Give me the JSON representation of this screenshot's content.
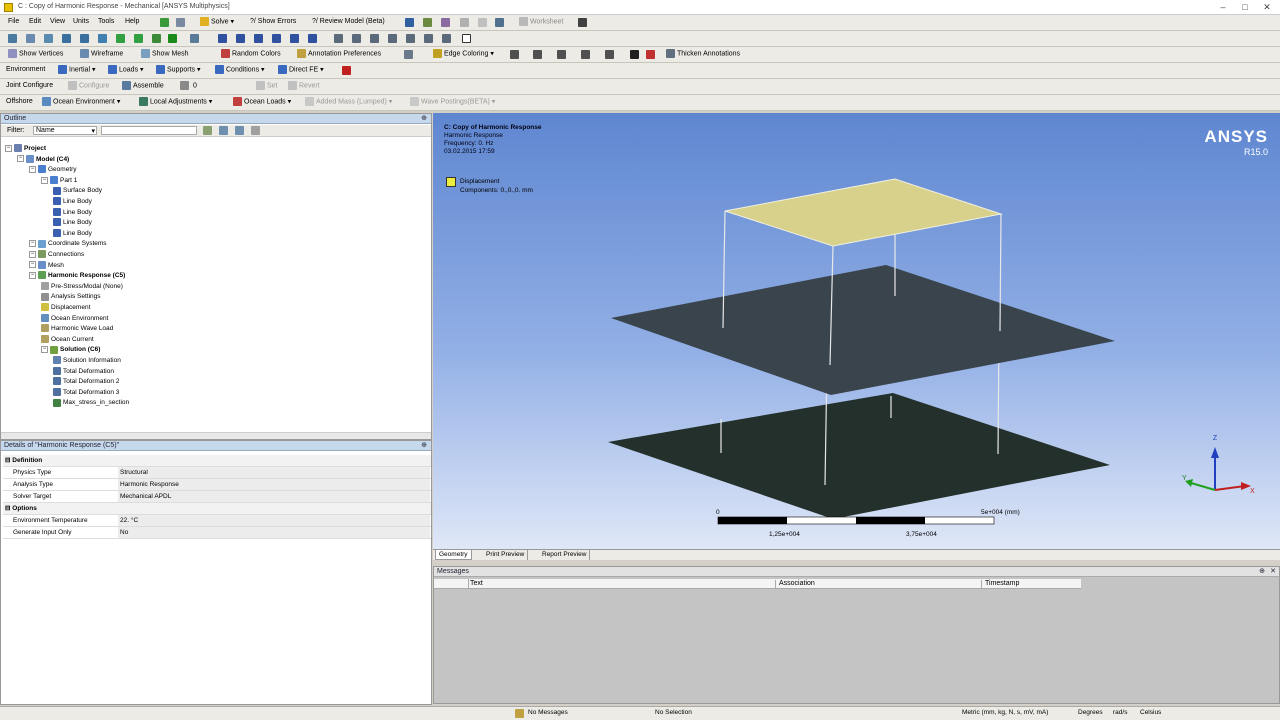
{
  "window": {
    "title": "C : Copy of Harmonic Response - Mechanical [ANSYS Multiphysics]"
  },
  "menu": [
    "File",
    "Edit",
    "View",
    "Units",
    "Tools",
    "Help"
  ],
  "toolbar1": {
    "solve": "Solve",
    "show_errors": "?/ Show Errors",
    "review_model": "?/ Review Model (Beta)",
    "worksheet": "Worksheet"
  },
  "toolbar2": {
    "show_vertices": "Show Vertices",
    "wireframe": "Wireframe",
    "show_mesh": "Show Mesh",
    "random_colors": "Random Colors",
    "annotation_prefs": "Annotation Preferences",
    "edge_coloring": "Edge Coloring",
    "thicken": "Thicken Annotations"
  },
  "toolbar3": {
    "label": "Environment",
    "inertial": "Inertial",
    "loads": "Loads",
    "supports": "Supports",
    "conditions": "Conditions",
    "direct_fe": "Direct FE"
  },
  "toolbar4": {
    "joint_configure": "Joint Configure",
    "configure": "Configure",
    "assemble": "Assemble",
    "set": "Set",
    "revert": "Revert"
  },
  "toolbar5": {
    "label": "Offshore",
    "ocean_env": "Ocean Environment",
    "local_adj": "Local Adjustments",
    "ocean_loads": "Ocean Loads",
    "added_mass": "Added Mass (Lumped)",
    "wave_postings": "Wave Postings(BETA)"
  },
  "outline": {
    "title": "Outline",
    "filter_label": "Filter:",
    "filter_value": "Name",
    "tree": [
      {
        "label": "Project",
        "level": 0,
        "bold": true,
        "color": "#6a7fb0"
      },
      {
        "label": "Model (C4)",
        "level": 1,
        "bold": true,
        "color": "#6a8fc8"
      },
      {
        "label": "Geometry",
        "level": 2,
        "color": "#4a7fd0"
      },
      {
        "label": "Part 1",
        "level": 3,
        "color": "#4a7fd0"
      },
      {
        "label": "Surface Body",
        "level": 4,
        "color": "#3a60b0"
      },
      {
        "label": "Line Body",
        "level": 4,
        "color": "#3a60b0"
      },
      {
        "label": "Line Body",
        "level": 4,
        "color": "#3a60b0"
      },
      {
        "label": "Line Body",
        "level": 4,
        "color": "#3a60b0"
      },
      {
        "label": "Line Body",
        "level": 4,
        "color": "#3a60b0"
      },
      {
        "label": "Coordinate Systems",
        "level": 2,
        "color": "#6aa0d0"
      },
      {
        "label": "Connections",
        "level": 2,
        "color": "#7a9a60"
      },
      {
        "label": "Mesh",
        "level": 2,
        "color": "#6a8fc8"
      },
      {
        "label": "Harmonic Response (C5)",
        "level": 2,
        "bold": true,
        "color": "#5aa050"
      },
      {
        "label": "Pre-Stress/Modal (None)",
        "level": 3,
        "color": "#a0a0a0"
      },
      {
        "label": "Analysis Settings",
        "level": 3,
        "color": "#909090"
      },
      {
        "label": "Displacement",
        "level": 3,
        "color": "#d0c040"
      },
      {
        "label": "Ocean Environment",
        "level": 3,
        "color": "#6090c0"
      },
      {
        "label": "Harmonic Wave Load",
        "level": 3,
        "color": "#b0a060"
      },
      {
        "label": "Ocean Current",
        "level": 3,
        "color": "#b0a060"
      },
      {
        "label": "Solution (C6)",
        "level": 3,
        "bold": true,
        "color": "#70a040"
      },
      {
        "label": "Solution Information",
        "level": 4,
        "color": "#6080b0"
      },
      {
        "label": "Total Deformation",
        "level": 4,
        "color": "#5070a0"
      },
      {
        "label": "Total Deformation 2",
        "level": 4,
        "color": "#5070a0"
      },
      {
        "label": "Total Deformation 3",
        "level": 4,
        "color": "#5070a0"
      },
      {
        "label": "Max_stress_in_section",
        "level": 4,
        "color": "#408040"
      }
    ]
  },
  "details": {
    "title": "Details of \"Harmonic Response (C5)\"",
    "rows": [
      {
        "section": "Definition"
      },
      {
        "key": "Physics Type",
        "value": "Structural"
      },
      {
        "key": "Analysis Type",
        "value": "Harmonic Response"
      },
      {
        "key": "Solver Target",
        "value": "Mechanical APDL"
      },
      {
        "section": "Options"
      },
      {
        "key": "Environment Temperature",
        "value": "22. °C"
      },
      {
        "key": "Generate Input Only",
        "value": "No"
      }
    ]
  },
  "viewport": {
    "heading": "C: Copy of Harmonic Response",
    "line2": "Harmonic Response",
    "line3": "Frequency: 0. Hz",
    "line4": "03.02.2015 17:59",
    "legend_title": "Displacement",
    "legend_sub": "Components: 0.,0.,0. mm",
    "brand": "ANSYS",
    "version": "R15.0",
    "scale_zero": "0",
    "scale_max": "5e+004 (mm)",
    "scale_q1": "1,25e+004",
    "scale_q3": "3,75e+004",
    "tabs": [
      "Geometry",
      "Print Preview",
      "Report Preview"
    ],
    "axis_z": "Z",
    "axis_x": "X",
    "axis_y": "Y",
    "yellow": "#d8d18b",
    "dark1": "#3a444c",
    "dark2": "#23302b"
  },
  "messages": {
    "title": "Messages",
    "cols": [
      "Text",
      "Association",
      "Timestamp"
    ]
  },
  "status": {
    "msgs": "No Messages",
    "sel": "No Selection",
    "units": "Metric (mm, kg, N, s, mV, mA)",
    "deg": "Degrees",
    "rads": "rad/s",
    "temp": "Celsius"
  }
}
